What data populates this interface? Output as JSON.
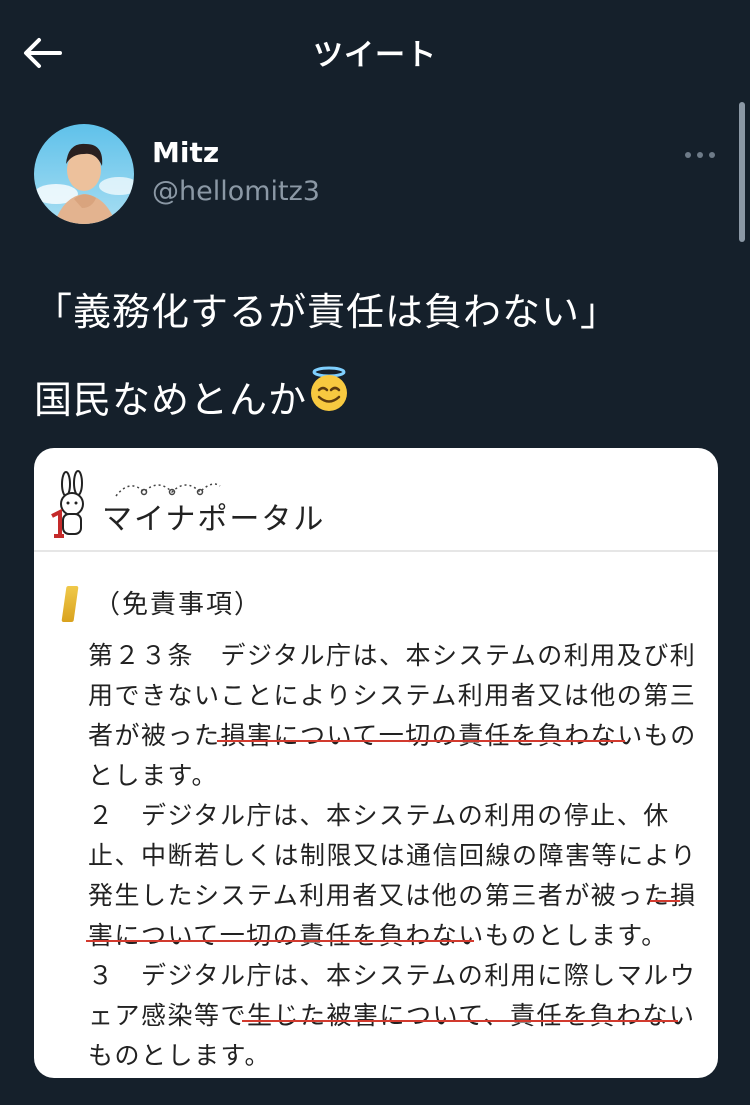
{
  "header": {
    "title": "ツイート"
  },
  "author": {
    "name": "Mitz",
    "handle": "@hellomitz3"
  },
  "tweet": {
    "line1": "「義務化するが責任は負わない」",
    "line2": "国民なめとんか",
    "emoji": "😇"
  },
  "card": {
    "portal_title": "マイナポータル",
    "section_title": "（免責事項）",
    "lines": [
      "第２３条　デジタル庁は、本システムの利用及び利",
      "用できないことによりシステム利用者又は他の第三",
      "者が被った損害について一切の責任を負わないもの",
      "とします。",
      "２　デジタル庁は、本システムの利用の停止、休",
      "止、中断若しくは制限又は通信回線の障害等により",
      "発生したシステム利用者又は他の第三者が被った損",
      "害について一切の責任を負わないものとします。",
      "３　デジタル庁は、本システムの利用に際しマルウ",
      "ェア感染等で生じた被害について、責任を負わない",
      "ものとします。"
    ]
  },
  "colors": {
    "background": "#15202b",
    "muted": "#8b98a5",
    "underline": "#d23a2e"
  }
}
